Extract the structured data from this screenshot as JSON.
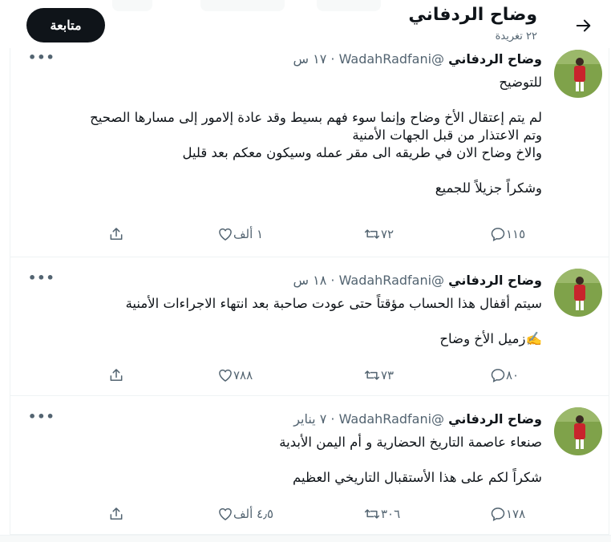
{
  "header": {
    "name": "وضاح الردفاني",
    "tweet_count": "٢٢ تغريدة",
    "follow_label": "متابعة",
    "back_icon": "arrow-right-icon"
  },
  "colors": {
    "text": "#0f1419",
    "muted": "#536471",
    "divider": "#eff3f4",
    "button_bg": "#0f1419"
  },
  "tweets": [
    {
      "name": "وضاح الردفاني",
      "handle": "@WadahRadfani",
      "time": "١٧ س",
      "lines": [
        "للتوضيح",
        "",
        "لم يتم إعتقال الأخ وضاح وإنما سوء فهم بسيط وقد عادة إلامور إلى مسارها الصحيح",
        "وتم الاعتذار من قبل الجهات الأمنية",
        "والاخ وضاح الان في طريقه الى مقر عمله وسيكون معكم بعد قليل",
        "",
        "وشكراً جزيلاً للجميع"
      ],
      "replies": "١١٥",
      "retweets": "٧٢",
      "likes": "١ ألف"
    },
    {
      "name": "وضاح الردفاني",
      "handle": "@WadahRadfani",
      "time": "١٨ س",
      "lines": [
        "سيتم أقفال هذا الحساب مؤقتاً حتى عودت صاحبة بعد انتهاء الاجراءات الأمنية",
        "",
        "✍️زميل الأخ وضاح"
      ],
      "replies": "٨٠",
      "retweets": "٧٣",
      "likes": "٧٨٨"
    },
    {
      "name": "وضاح الردفاني",
      "handle": "@WadahRadfani",
      "time": "٧ يناير",
      "lines": [
        "صنعاء عاصمة التاريخ الحضارية و أم اليمن الأبدية",
        "",
        "شكراً لكم على هذا الأستقبال التاريخي العظيم"
      ],
      "replies": "١٧٨",
      "retweets": "٣٠٦",
      "likes": "٤٫٥ ألف"
    }
  ],
  "separator": "·",
  "more_label": "•••"
}
